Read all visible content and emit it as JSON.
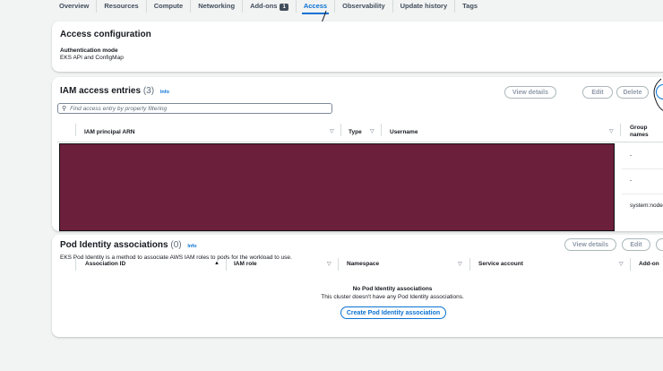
{
  "tabs": [
    {
      "label": "Overview"
    },
    {
      "label": "Resources"
    },
    {
      "label": "Compute"
    },
    {
      "label": "Networking"
    },
    {
      "label": "Add-ons",
      "badge": "1"
    },
    {
      "label": "Access",
      "active": true
    },
    {
      "label": "Observability"
    },
    {
      "label": "Update history"
    },
    {
      "label": "Tags"
    }
  ],
  "access_config": {
    "title": "Access configuration",
    "auth_label": "Authentication mode",
    "auth_value": "EKS API and ConfigMap"
  },
  "iam": {
    "title": "IAM access entries",
    "count": "(3)",
    "info": "Info",
    "buttons": {
      "view": "View details",
      "edit": "Edit",
      "delete": "Delete"
    },
    "search_placeholder": "Find access entry by property filtering",
    "columns": [
      "IAM principal ARN",
      "Type",
      "Username",
      "Group names"
    ],
    "group_values": [
      "-",
      "-",
      "system:node"
    ],
    "redaction_color": "#6b1f3a"
  },
  "pod": {
    "title": "Pod Identity associations",
    "count": "(0)",
    "info": "Info",
    "description": "EKS Pod Identity is a method to associate AWS IAM roles to pods for the workload to use.",
    "buttons": {
      "view": "View details",
      "edit": "Edit"
    },
    "columns": [
      "Association ID",
      "IAM role",
      "Namespace",
      "Service account",
      "Add-on"
    ],
    "empty_title": "No Pod Identity associations",
    "empty_desc": "This cluster doesn't have any Pod Identity associations.",
    "create_button": "Create Pod Identity association"
  }
}
